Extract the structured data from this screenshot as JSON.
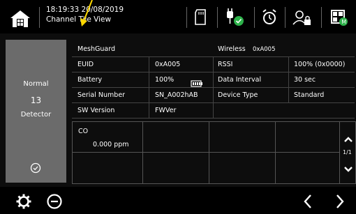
{
  "header": {
    "time": "18:19:33",
    "date": "20/08/2019",
    "view_name": "Channel Tile View"
  },
  "detector_panel": {
    "status": "Normal",
    "number": "13",
    "type": "Detector"
  },
  "info": {
    "device_name": "MeshGuard",
    "wireless_label": "Wireless",
    "wireless_value": "0xA005",
    "rows": [
      {
        "label": "EUID",
        "value": "0xA005",
        "label2": "RSSI",
        "value2": "100%  (0x0000)"
      },
      {
        "label": "Battery",
        "value": "100%",
        "label2": "Data Interval",
        "value2": "30 sec"
      },
      {
        "label": "Serial Number",
        "value": "SN_A002hAB",
        "label2": "Device Type",
        "value2": "Standard"
      },
      {
        "label": "SW Version",
        "value": "FWVer",
        "label2": "",
        "value2": ""
      }
    ]
  },
  "sensor": {
    "name": "CO",
    "reading": "0.000 ppm"
  },
  "pager": {
    "page": "1/1"
  },
  "icons": {
    "home": "home-icon",
    "sd_card": "sd-card-icon",
    "power_plug": "power-plug-icon",
    "alarm_clock": "alarm-clock-icon",
    "user_lock": "user-lock-icon",
    "layout": "layout-icon",
    "settings": "gear-icon",
    "minus": "minus-circle-icon",
    "prev": "chevron-left-icon",
    "next": "chevron-right-icon"
  },
  "colors": {
    "status_green": "#2db24a",
    "panel_gray": "#6b6b6b",
    "annotation_yellow": "#ffd800"
  }
}
